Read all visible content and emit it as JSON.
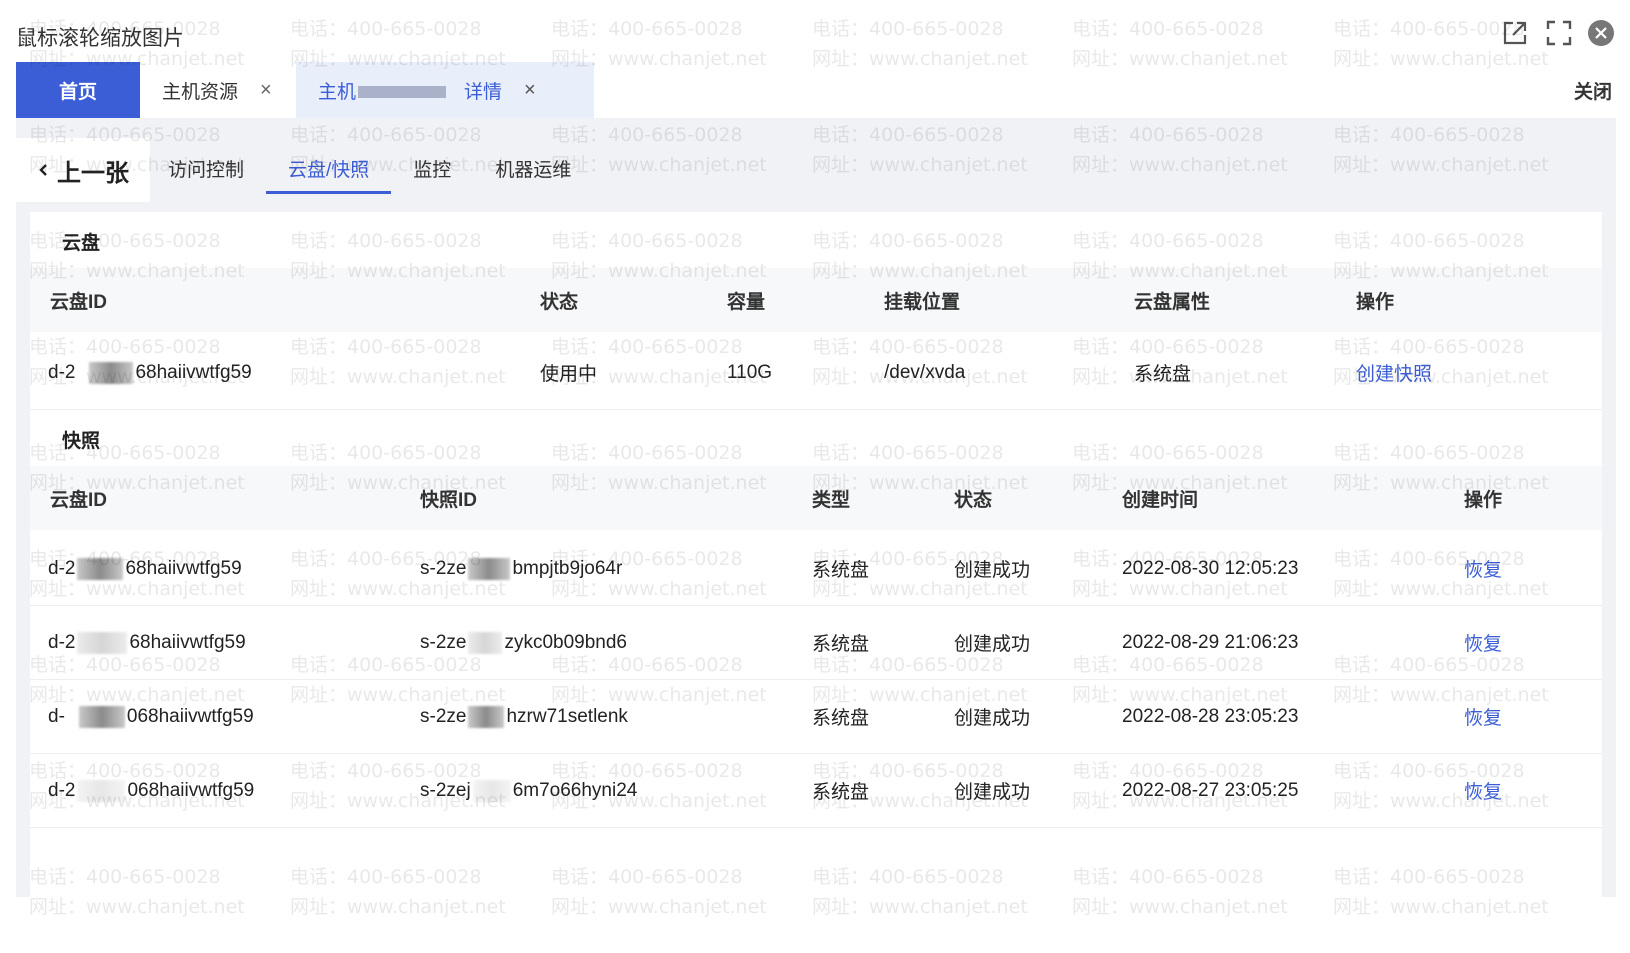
{
  "viewer": {
    "title": "鼠标滚轮缩放图片",
    "icons": [
      "open-external-icon",
      "fullscreen-icon",
      "close-icon"
    ]
  },
  "tabs": {
    "home": "首页",
    "resource": "主机资源",
    "detail_prefix": "主机",
    "detail_suffix": "详情",
    "close_mark": "×",
    "close_all": "关闭"
  },
  "prev": {
    "label": "上一张"
  },
  "subtabs": [
    "访问控制",
    "云盘/快照",
    "监控",
    "机器运维"
  ],
  "active_subtab": "云盘/快照",
  "disk": {
    "title": "云盘",
    "headers": [
      "云盘ID",
      "状态",
      "容量",
      "挂载位置",
      "云盘属性",
      "操作"
    ],
    "row": {
      "id_a": "d-2",
      "id_b": "68haiivwtfg59",
      "status": "使用中",
      "capacity": "110G",
      "mount": "/dev/xvda",
      "attr": "系统盘",
      "action": "创建快照"
    }
  },
  "snapshot": {
    "title": "快照",
    "headers": [
      "云盘ID",
      "快照ID",
      "类型",
      "状态",
      "创建时间",
      "操作"
    ],
    "rows": [
      {
        "disk_a": "d-2",
        "disk_b": "68haiivwtfg59",
        "snap_a": "s-2ze",
        "snap_b": "bmpjtb9jo64r",
        "type": "系统盘",
        "status": "创建成功",
        "time": "2022-08-30 12:05:23",
        "action": "恢复"
      },
      {
        "disk_a": "d-2",
        "disk_b": "68haiivwtfg59",
        "snap_a": "s-2ze",
        "snap_b": "zykc0b09bnd6",
        "type": "系统盘",
        "status": "创建成功",
        "time": "2022-08-29 21:06:23",
        "action": "恢复"
      },
      {
        "disk_a": "d-",
        "disk_b": "068haiivwtfg59",
        "snap_a": "s-2ze",
        "snap_b": "hzrw71setlenk",
        "type": "系统盘",
        "status": "创建成功",
        "time": "2022-08-28 23:05:23",
        "action": "恢复"
      },
      {
        "disk_a": "d-2",
        "disk_b": "068haiivwtfg59",
        "snap_a": "s-2zej",
        "snap_b": "6m7o66hyni24",
        "type": "系统盘",
        "status": "创建成功",
        "time": "2022-08-27 23:05:25",
        "action": "恢复"
      }
    ]
  },
  "watermark": {
    "phone": "电话：400-665-0028",
    "site": "网址：www.chanjet.net"
  },
  "colors": {
    "accent": "#3b5ed6",
    "tab_active_bg": "#e9eefb"
  }
}
